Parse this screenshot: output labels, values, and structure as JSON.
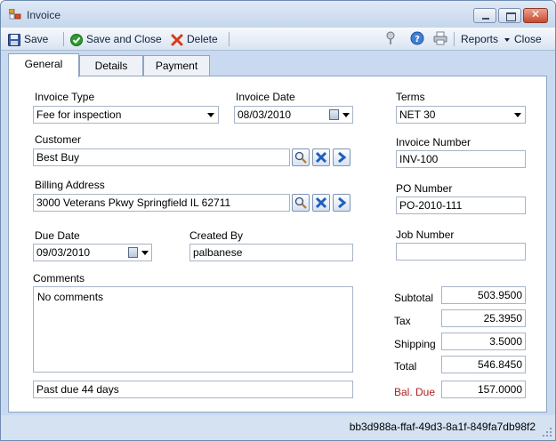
{
  "window": {
    "title": "Invoice"
  },
  "toolbar": {
    "save": "Save",
    "save_close": "Save and Close",
    "delete": "Delete",
    "reports": "Reports",
    "close": "Close"
  },
  "tabs": [
    "General",
    "Details",
    "Payment"
  ],
  "form": {
    "invoice_type": {
      "label": "Invoice Type",
      "value": "Fee for inspection"
    },
    "invoice_date": {
      "label": "Invoice Date",
      "value": "08/03/2010"
    },
    "terms": {
      "label": "Terms",
      "value": "NET 30"
    },
    "customer": {
      "label": "Customer",
      "value": "Best Buy"
    },
    "invoice_number": {
      "label": "Invoice Number",
      "value": "INV-100"
    },
    "billing_address": {
      "label": "Billing Address",
      "value": "3000  Veterans Pkwy  Springfield IL 62711"
    },
    "po_number": {
      "label": "PO Number",
      "value": "PO-2010-111"
    },
    "due_date": {
      "label": "Due Date",
      "value": "09/03/2010"
    },
    "created_by": {
      "label": "Created By",
      "value": "palbanese"
    },
    "job_number": {
      "label": "Job Number",
      "value": ""
    },
    "comments": {
      "label": "Comments",
      "value": "No comments"
    },
    "status_note": "Past due 44 days"
  },
  "totals": {
    "subtotal": {
      "label": "Subtotal",
      "value": "503.9500"
    },
    "tax": {
      "label": "Tax",
      "value": "25.3950"
    },
    "shipping": {
      "label": "Shipping",
      "value": "3.5000"
    },
    "total": {
      "label": "Total",
      "value": "546.8450"
    },
    "bal_due": {
      "label": "Bal. Due",
      "value": "157.0000"
    }
  },
  "statusbar": {
    "record_id": "bb3d988a-ffaf-49d3-8a1f-849fa7db98f2"
  },
  "colors": {
    "bal_due_label": "#b02020",
    "window_frame": "#c9daf0"
  }
}
